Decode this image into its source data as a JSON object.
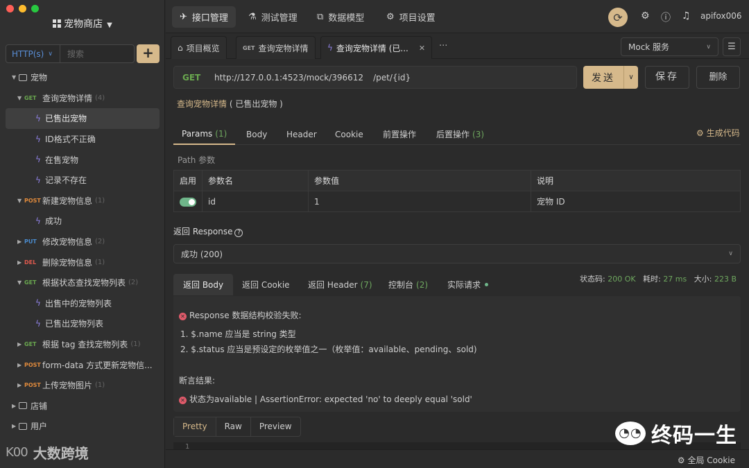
{
  "sidebar": {
    "project_name": "宠物商店",
    "method_filter": "HTTP(s)",
    "search_placeholder": "搜索",
    "add_label": "+",
    "tree": [
      {
        "kind": "folder",
        "label": "宠物",
        "expanded": true
      },
      {
        "kind": "api",
        "method": "GET",
        "label": "查询宠物详情",
        "count": "(4)"
      },
      {
        "kind": "case",
        "label": "已售出宠物",
        "active": true
      },
      {
        "kind": "case",
        "label": "ID格式不正确"
      },
      {
        "kind": "case",
        "label": "在售宠物"
      },
      {
        "kind": "case",
        "label": "记录不存在"
      },
      {
        "kind": "api",
        "method": "POST",
        "label": "新建宠物信息",
        "count": "(1)"
      },
      {
        "kind": "case",
        "label": "成功"
      },
      {
        "kind": "api",
        "method": "PUT",
        "label": "修改宠物信息",
        "count": "(2)",
        "collapsed": true
      },
      {
        "kind": "api",
        "method": "DEL",
        "label": "删除宠物信息",
        "count": "(1)",
        "collapsed": true
      },
      {
        "kind": "api",
        "method": "GET",
        "label": "根据状态查找宠物列表",
        "count": "(2)"
      },
      {
        "kind": "case",
        "label": "出售中的宠物列表"
      },
      {
        "kind": "case",
        "label": "已售出宠物列表"
      },
      {
        "kind": "api",
        "method": "GET",
        "label": "根据 tag 查找宠物列表",
        "count": "(1)",
        "collapsed": true
      },
      {
        "kind": "api",
        "method": "POST",
        "label": "form-data 方式更新宠物信...",
        "count": "",
        "collapsed": true
      },
      {
        "kind": "api",
        "method": "POST",
        "label": "上传宠物图片",
        "count": "(1)",
        "collapsed": true
      },
      {
        "kind": "folder",
        "label": "店铺",
        "expanded": false
      },
      {
        "kind": "folder",
        "label": "用户",
        "expanded": false
      }
    ],
    "watermark": "大数跨境",
    "watermark_logo": "K00"
  },
  "topnav": {
    "tabs": [
      {
        "label": "接口管理",
        "icon": "send-icon",
        "selected": true
      },
      {
        "label": "测试管理",
        "icon": "flask-icon"
      },
      {
        "label": "数据模型",
        "icon": "model-icon"
      },
      {
        "label": "项目设置",
        "icon": "gear-icon"
      }
    ],
    "user": "apifox006"
  },
  "doc_tabs": [
    {
      "label": "项目概览",
      "icon": "bank-icon"
    },
    {
      "label": "查询宠物详情",
      "method": "GET"
    },
    {
      "label": "查询宠物详情 (已...",
      "icon": "bolt-icon",
      "selected": true
    }
  ],
  "mock_service": "Mock 服务",
  "request": {
    "method": "GET",
    "base_url": "http://127.0.0.1:4523/mock/396612",
    "path": "/pet/{id}",
    "send_label": "发送",
    "save_label": "保存",
    "delete_label": "删除",
    "case_name": "查询宠物详情",
    "case_sub": "( 已售出宠物 )"
  },
  "subtabs": [
    {
      "label": "Params",
      "count": "(1)",
      "selected": true
    },
    {
      "label": "Body"
    },
    {
      "label": "Header"
    },
    {
      "label": "Cookie"
    },
    {
      "label": "前置操作"
    },
    {
      "label": "后置操作",
      "count": "(3)"
    }
  ],
  "generate_code": "生成代码",
  "path_params_label": "Path 参数",
  "params_table": {
    "headers": [
      "启用",
      "参数名",
      "参数值",
      "说明"
    ],
    "rows": [
      {
        "enabled": true,
        "name": "id",
        "value": "1",
        "desc": "宠物 ID"
      }
    ]
  },
  "response_label": "返回 Response",
  "response_select": "成功 (200)",
  "resp_tabs": [
    {
      "label": "返回 Body",
      "selected": true
    },
    {
      "label": "返回 Cookie"
    },
    {
      "label": "返回 Header",
      "count": "(7)"
    },
    {
      "label": "控制台",
      "count": "(2)"
    },
    {
      "label": "实际请求",
      "dot": true
    }
  ],
  "stats": {
    "status_label": "状态码:",
    "status": "200 OK",
    "time_label": "耗时:",
    "time": "27 ms",
    "size_label": "大小:",
    "size": "223 B"
  },
  "result": {
    "schema_error": "Response 数据结构校验失败:",
    "errors": [
      "1. $.name 应当是 string 类型",
      "2. $.status 应当是预设定的枚举值之一（枚举值：available、pending、sold)"
    ],
    "assert_title": "断言结果:",
    "assert_fail": "状态为available | AssertionError: expected 'no' to deeply equal 'sold'"
  },
  "view_tabs": [
    "Pretty",
    "Raw",
    "Preview"
  ],
  "line_number": "1",
  "footer_cookie": "全局 Cookie",
  "watermark_right": "终码一生"
}
